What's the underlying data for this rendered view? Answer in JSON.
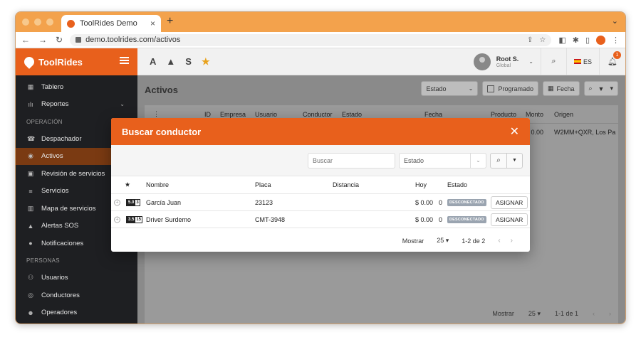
{
  "browser": {
    "tab_title": "ToolRides Demo",
    "url": "demo.toolrides.com/activos",
    "new_tab": "+",
    "tab_close": "×"
  },
  "sidebar": {
    "brand": "ToolRides",
    "items": [
      {
        "label": "Tablero",
        "icon": "dashboard-icon",
        "glyph": "▦"
      },
      {
        "label": "Reportes",
        "icon": "chart-icon",
        "glyph": "ılı",
        "chevron": "⌄"
      }
    ],
    "section_operacion": "OPERACIÓN",
    "operacion_items": [
      {
        "label": "Despachador",
        "icon": "phone-icon",
        "glyph": "☎"
      },
      {
        "label": "Activos",
        "icon": "radio-icon",
        "glyph": "◉",
        "active": true
      },
      {
        "label": "Revisión de servicios",
        "icon": "review-icon",
        "glyph": "▣"
      },
      {
        "label": "Servicios",
        "icon": "list-icon",
        "glyph": "≡"
      },
      {
        "label": "Mapa de servicios",
        "icon": "map-icon",
        "glyph": "▥"
      },
      {
        "label": "Alertas SOS",
        "icon": "warning-icon",
        "glyph": "▲"
      },
      {
        "label": "Notificaciones",
        "icon": "bell-icon",
        "glyph": "●"
      }
    ],
    "section_personas": "PERSONAS",
    "personas_items": [
      {
        "label": "Usuarios",
        "icon": "users-icon",
        "glyph": "⚇"
      },
      {
        "label": "Conductores",
        "icon": "driver-icon",
        "glyph": "◎"
      },
      {
        "label": "Operadores",
        "icon": "operator-icon",
        "glyph": "☻"
      }
    ]
  },
  "header": {
    "font_a": "A",
    "warn": "▲",
    "s": "S",
    "star": "★",
    "user_name": "Root S.",
    "user_role": "Global",
    "lang": "ES",
    "notif_count": "1"
  },
  "page": {
    "title": "Activos",
    "estado": "Estado",
    "programado": "Programado",
    "fecha": "Fecha",
    "columns": [
      "ID",
      "Empresa",
      "Usuario",
      "Conductor",
      "Estado",
      "Fecha",
      "Producto",
      "Monto",
      "Origen"
    ],
    "row_monto": "$ 0.00",
    "row_origen": "W2MM+QXR, Los Pa",
    "footer_show": "Mostrar",
    "footer_count": "25",
    "footer_range": "1-1 de 1"
  },
  "modal": {
    "title": "Buscar conductor",
    "close": "✕",
    "search_placeholder": "Buscar",
    "estado_label": "Estado",
    "columns": {
      "star": "★",
      "nombre": "Nombre",
      "placa": "Placa",
      "distancia": "Distancia",
      "hoy": "Hoy",
      "estado": "Estado"
    },
    "rows": [
      {
        "rating": "5.0",
        "reviews": "3",
        "nombre": "García Juan",
        "placa": "23123",
        "hoy": "$ 0.00",
        "count": "0",
        "status": "DESCONECTADO",
        "action": "ASIGNAR"
      },
      {
        "rating": "3.5",
        "reviews": "15",
        "nombre": "Driver Surdemo",
        "placa": "CMT-3948",
        "hoy": "$ 0.00",
        "count": "0",
        "status": "DESCONECTADO",
        "action": "ASIGNAR"
      }
    ],
    "footer_show": "Mostrar",
    "footer_count": "25",
    "footer_range": "1-2 de 2"
  },
  "colors": {
    "brand": "#e8601c",
    "sidebar": "#1e1f22",
    "status": "#9aa4b0"
  }
}
